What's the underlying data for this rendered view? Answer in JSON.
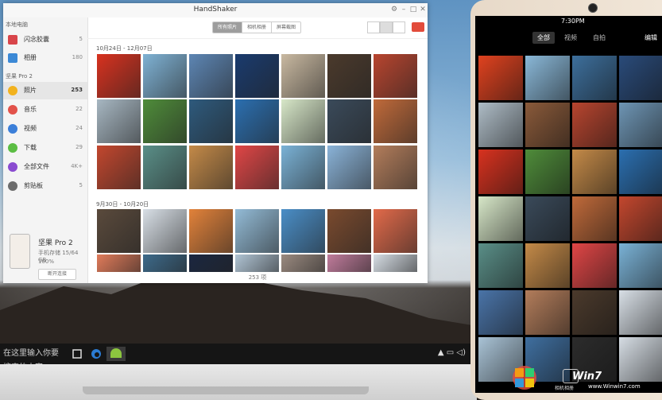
{
  "window": {
    "title": "HandShaker"
  },
  "sidebar": {
    "local_header": "本地电脑",
    "local_items": [
      {
        "label": "闪念胶囊",
        "count": "5",
        "color": "#d8454a"
      },
      {
        "label": "相册",
        "count": "180",
        "color": "#3c89d6"
      }
    ],
    "device_header": "坚果 Pro 2",
    "device_items": [
      {
        "label": "照片",
        "count": "253",
        "color": "#f2b21e"
      },
      {
        "label": "音乐",
        "count": "22",
        "color": "#e2524a"
      },
      {
        "label": "视频",
        "count": "24",
        "color": "#3b7fd9"
      },
      {
        "label": "下载",
        "count": "29",
        "color": "#5bbd43"
      },
      {
        "label": "全部文件",
        "count": "4K+",
        "color": "#8a4bd0"
      },
      {
        "label": "剪贴板",
        "count": "5",
        "color": "#6c6c6c"
      }
    ],
    "device": {
      "name": "坚果 Pro 2",
      "storage": "手机存储 15/64 GB",
      "battery": "100%",
      "disconnect_label": "断开连接"
    }
  },
  "toolbar": {
    "tabs": [
      "所有照片",
      "相机相册",
      "屏幕截图"
    ],
    "active_tab": 0
  },
  "sections": [
    {
      "label": "10月24日 - 12月07日"
    },
    {
      "label": "9月30日 - 10月20日"
    }
  ],
  "status": {
    "count_label": "253 项"
  },
  "photo_colors": [
    [
      "#d8321f",
      "#7fb2d4",
      "#5d86b4",
      "#1a3b6e",
      "#c9b9a1",
      "#4b3a2c",
      "#b8452f"
    ],
    [
      "#a7b7c2",
      "#4f8c3a",
      "#2e5a7d",
      "#2b6fb0",
      "#d7e7c8",
      "#3a4a5a",
      "#c06a3a"
    ],
    [
      "#c3472e",
      "#5a8f88",
      "#c48a48",
      "#e04646",
      "#7ab2d6",
      "#8ab3d8",
      "#b37d5b"
    ],
    [
      "#5a4a3c",
      "#d8dfe6",
      "#e2823a",
      "#93bbd6",
      "#4a8ec7",
      "#7a4a2e",
      "#e26a4a"
    ],
    [
      "#e07b5a",
      "#3d6a8a",
      "#1b2740",
      "#b0c4d4",
      "#9a8a80",
      "#c07b9b",
      "#d6dde4"
    ]
  ],
  "phone": {
    "time": "7:30PM",
    "tabs": [
      "全部",
      "视频",
      "自拍"
    ],
    "active_tab": 0,
    "edit_label": "编辑",
    "camera_label": "相机相册",
    "photo_colors": [
      [
        "#e0421f",
        "#8ab8d8",
        "#3d6f9c",
        "#2a4b7a"
      ],
      [
        "#aebcc6",
        "#8a5a3a",
        "#b8452f",
        "#6e95b4"
      ],
      [
        "#d8321f",
        "#4f8c3a",
        "#c48a48",
        "#2b6fb0"
      ],
      [
        "#d7e7c8",
        "#3a4a5a",
        "#c06a3a",
        "#c3472e"
      ],
      [
        "#5a8f88",
        "#c48a48",
        "#e04646",
        "#7ab2d6"
      ],
      [
        "#4a74a8",
        "#b37d5b",
        "#4b3a2c",
        "#d8dfe6"
      ],
      [
        "#a9c3d6",
        "#3f6fa0",
        "#2c2c2c",
        "#d6dde4"
      ]
    ]
  },
  "watermark": {
    "text": "Win7",
    "sub": "www.Winwin7.com"
  },
  "taskbar": {
    "search_text": "在这里输入你要搜索的内容"
  }
}
